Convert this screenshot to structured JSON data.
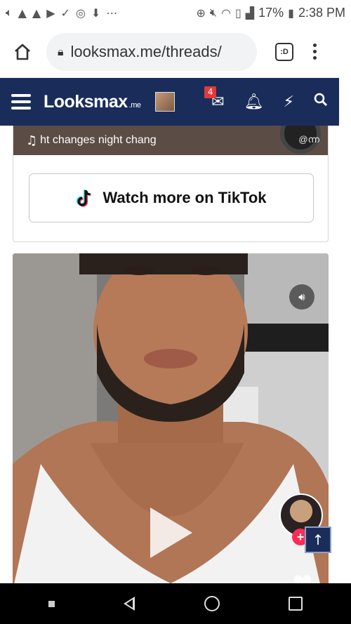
{
  "status_bar": {
    "icons": [
      "volume-icon",
      "android-icon",
      "android-icon",
      "youtube-icon",
      "check-icon",
      "instagram-icon",
      "download-icon",
      "more-icon",
      "data-saver-icon",
      "mute-icon",
      "wifi-icon",
      "no-sim-icon",
      "signal-icon"
    ],
    "battery": "17%",
    "time": "2:38 PM"
  },
  "browser": {
    "url": "looksmax.me/threads/",
    "tab_label": ":D"
  },
  "site_nav": {
    "logo": "Looksmax",
    "logo_suffix": ".me",
    "inbox_count": "4",
    "icons": [
      "hamburger-icon",
      "avatar",
      "inbox-icon",
      "bell-icon",
      "lightning-icon",
      "search-icon"
    ]
  },
  "embed": {
    "music_text": "ht changes   night chang",
    "handle": "@ന്ന",
    "watch_more_label": "Watch more on TikTok"
  },
  "video": {
    "follow_symbol": "+",
    "scroll_top_symbol": "↑"
  },
  "colors": {
    "nav_bg": "#1a2d5a",
    "badge": "#e03a3a",
    "tiktok_pink": "#fe2c55",
    "tiktok_cyan": "#25f4ee"
  }
}
